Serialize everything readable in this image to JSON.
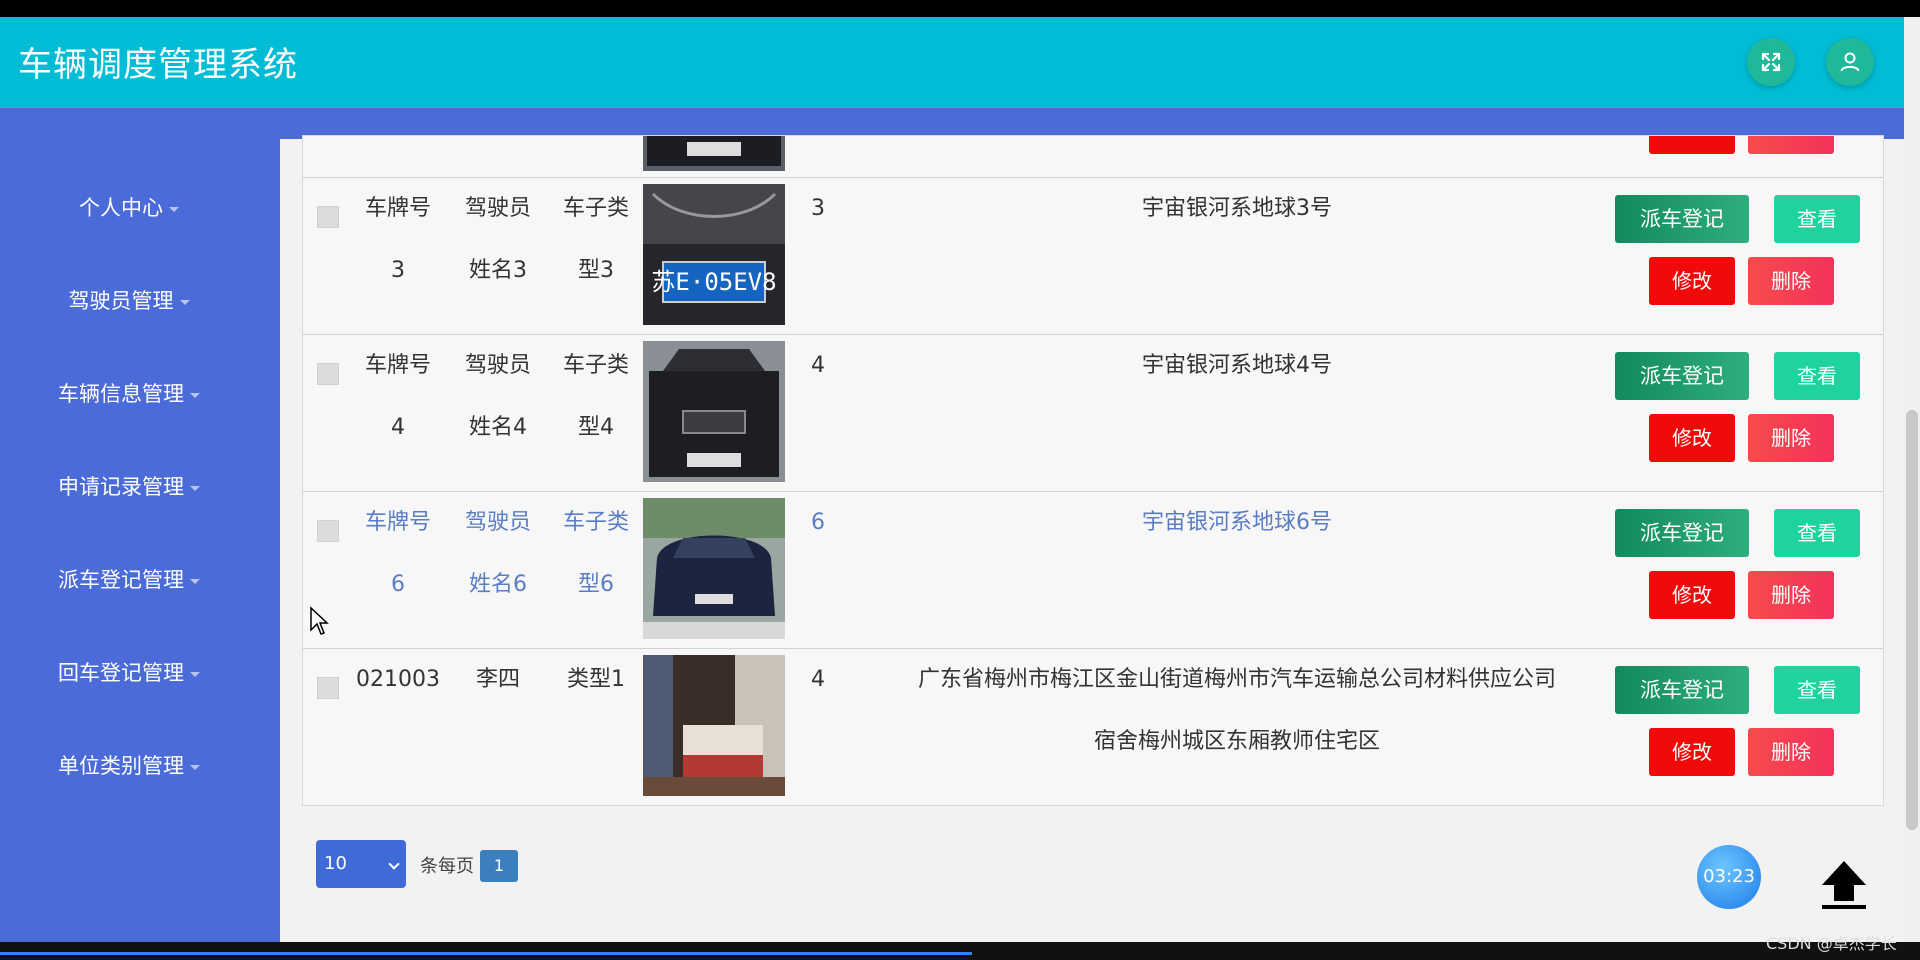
{
  "app": {
    "title": "车辆调度管理系统"
  },
  "topbar": {
    "icons": [
      "fullscreen-icon",
      "user-icon"
    ]
  },
  "sidebar": {
    "items": [
      {
        "label": "个人中心"
      },
      {
        "label": "驾驶员管理"
      },
      {
        "label": "车辆信息管理"
      },
      {
        "label": "申请记录管理"
      },
      {
        "label": "派车登记管理"
      },
      {
        "label": "回车登记管理"
      },
      {
        "label": "单位类别管理"
      }
    ]
  },
  "actions": {
    "dispatch": "派车登记",
    "view": "查看",
    "edit": "修改",
    "delete": "删除"
  },
  "rows": [
    {
      "plate_1": "车牌号",
      "plate_2": "3",
      "driver_1": "驾驶员",
      "driver_2": "姓名3",
      "type_1": "车子类",
      "type_2": "型3",
      "seats": "3",
      "addr_1": "宇宙银河系地球3号",
      "addr_2": ""
    },
    {
      "plate_1": "车牌号",
      "plate_2": "4",
      "driver_1": "驾驶员",
      "driver_2": "姓名4",
      "type_1": "车子类",
      "type_2": "型4",
      "seats": "4",
      "addr_1": "宇宙银河系地球4号",
      "addr_2": ""
    },
    {
      "plate_1": "车牌号",
      "plate_2": "6",
      "driver_1": "驾驶员",
      "driver_2": "姓名6",
      "type_1": "车子类",
      "type_2": "型6",
      "seats": "6",
      "addr_1": "宇宙银河系地球6号",
      "addr_2": ""
    },
    {
      "plate_1": "021003",
      "plate_2": "",
      "driver_1": "李四",
      "driver_2": "",
      "type_1": "类型1",
      "type_2": "",
      "seats": "4",
      "addr_1": "广东省梅州市梅江区金山街道梅州市汽车运输总公司材料供应公司",
      "addr_2": "宿舍梅州城区东厢教师住宅区"
    }
  ],
  "pagination": {
    "page_size": "10",
    "per_page_label": "条每页",
    "current_page": "1"
  },
  "overlay": {
    "timer": "03:23",
    "watermark": "CSDN @卓杰学长"
  },
  "colors": {
    "header": "#00bcd4",
    "sidebar": "#4a6bd8",
    "dispatch": "#128a5e",
    "view": "#1ed39d",
    "edit": "#f00a0a",
    "delete": "#f4325b"
  }
}
